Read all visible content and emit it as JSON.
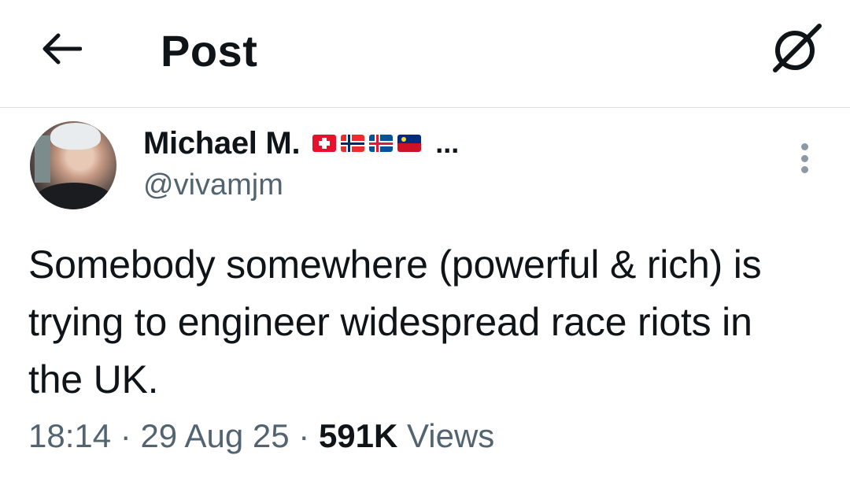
{
  "header": {
    "title": "Post",
    "back_icon": "arrow-left-icon",
    "grok_icon": "grok-icon"
  },
  "author": {
    "display_name": "Michael M.",
    "flags": [
      "Switzerland",
      "Norway",
      "Iceland",
      "Liechtenstein"
    ],
    "name_truncation": "...",
    "handle": "@vivamjm"
  },
  "post": {
    "text": "Somebody somewhere (powerful & rich) is trying to engineer widespread race riots in the UK."
  },
  "meta": {
    "time": "18:14",
    "separator1": " · ",
    "date": "29 Aug 25",
    "separator2": " · ",
    "views_count": "591K",
    "views_label": " Views"
  },
  "colors": {
    "text": "#0f1419",
    "secondary": "#536471",
    "divider": "#dcdfe2"
  }
}
